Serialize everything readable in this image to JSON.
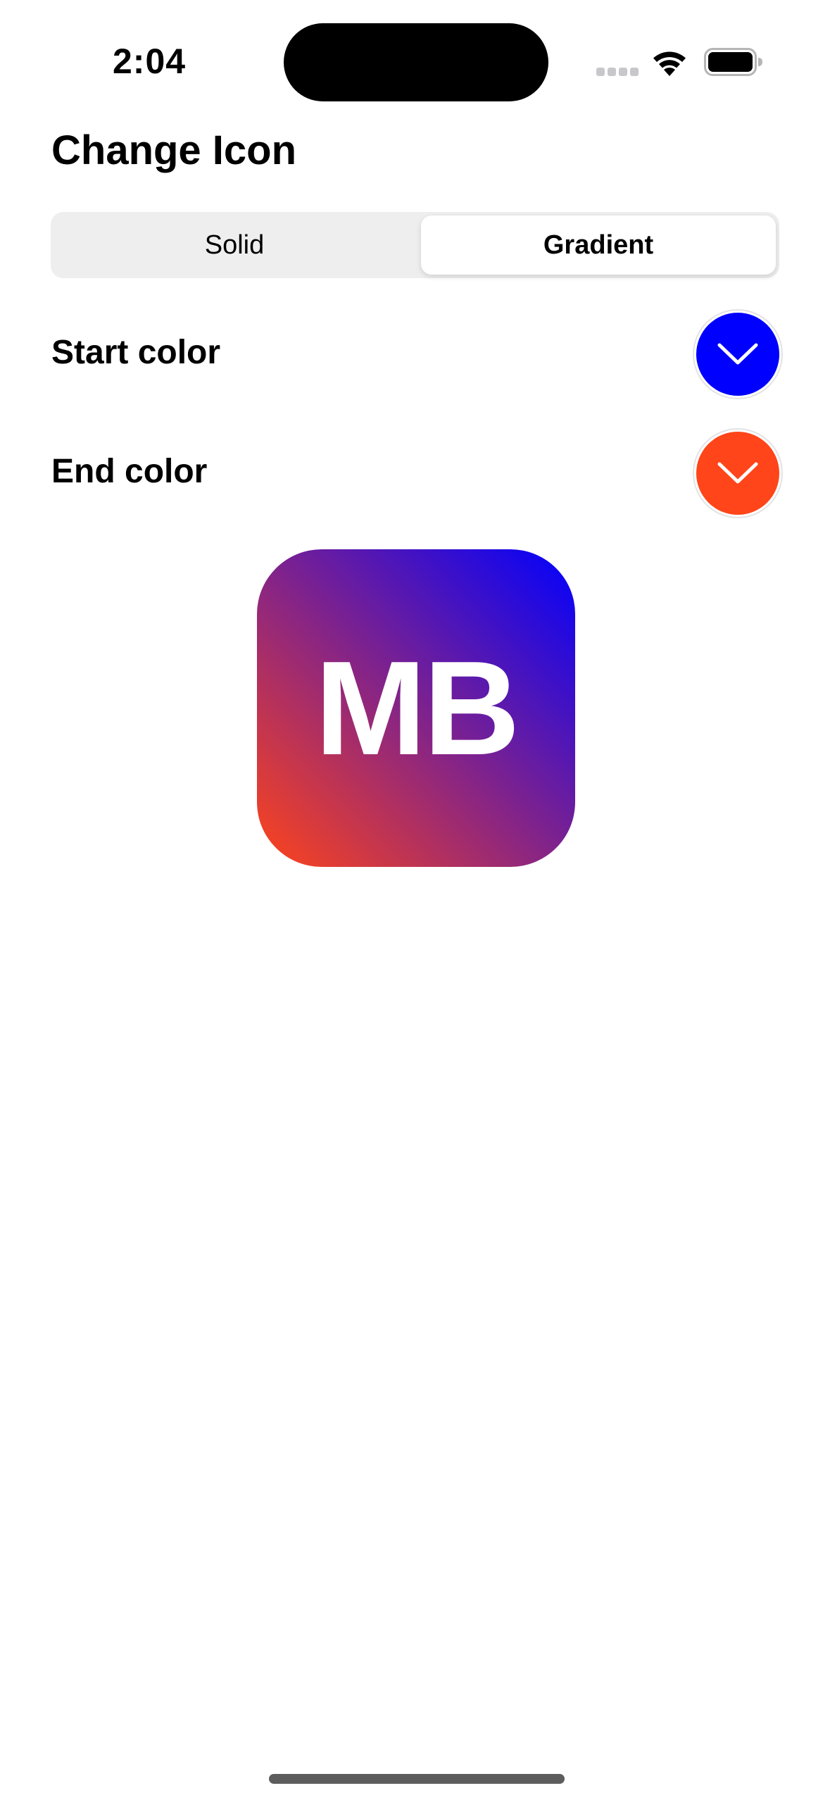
{
  "status_bar": {
    "time": "2:04"
  },
  "title": "Change Icon",
  "segmented_control": {
    "options": [
      "Solid",
      "Gradient"
    ],
    "selected": "Gradient"
  },
  "colors": {
    "start_label": "Start color",
    "start_value": "#0000FF",
    "end_label": "End color",
    "end_value": "#FF4519"
  },
  "icon_preview": {
    "text": "MB",
    "gradient_start": "#0000FF",
    "gradient_end": "#FF4519"
  },
  "icons": {
    "picker_chevron": "chevron-down-icon",
    "signal": "cellular-signal-icon",
    "wifi": "wifi-icon",
    "battery": "battery-icon"
  }
}
